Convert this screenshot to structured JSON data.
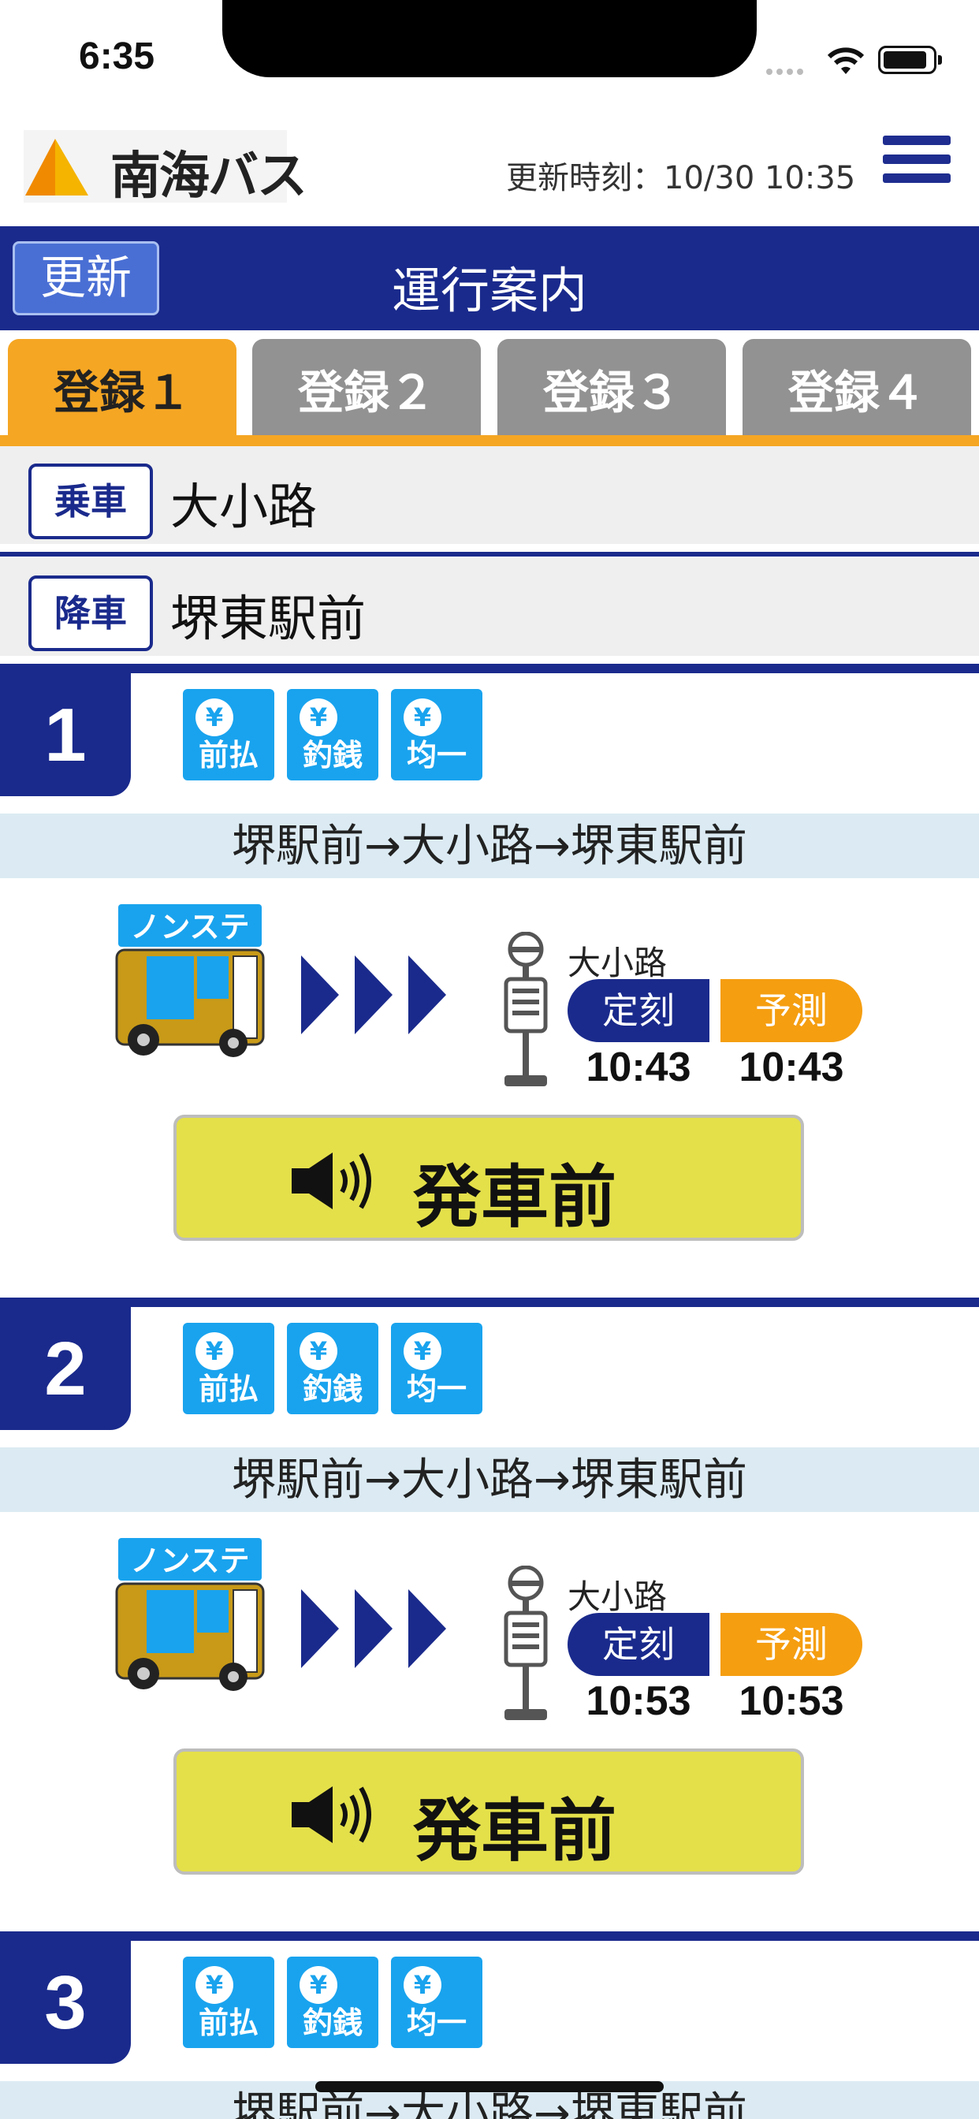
{
  "status_bar": {
    "time": "6:35"
  },
  "header": {
    "brand": "南海バス",
    "updated": "更新時刻：10/30 10:35"
  },
  "titlebar": {
    "refresh_label": "更新",
    "title": "運行案内"
  },
  "tabs": [
    {
      "label": "登録１",
      "active": true
    },
    {
      "label": "登録２",
      "active": false
    },
    {
      "label": "登録３",
      "active": false
    },
    {
      "label": "登録４",
      "active": false
    }
  ],
  "boarding": {
    "label": "乗車",
    "stop": "大小路"
  },
  "alighting": {
    "label": "降車",
    "stop": "堺東駅前"
  },
  "features": [
    {
      "icon": "yen-icon",
      "symbol": "¥",
      "label": "前払"
    },
    {
      "icon": "hand-coin-icon",
      "symbol": "¥",
      "label": "釣銭"
    },
    {
      "icon": "yen-icon",
      "symbol": "¥",
      "label": "均一"
    }
  ],
  "buses": [
    {
      "number": "1",
      "route": "堺駅前→大小路→堺東駅前",
      "bus_tag": "ノンステ",
      "stop": "大小路",
      "scheduled_label": "定刻",
      "predicted_label": "予測",
      "scheduled": "10:43",
      "predicted": "10:43",
      "status": "発車前"
    },
    {
      "number": "2",
      "route": "堺駅前→大小路→堺東駅前",
      "bus_tag": "ノンステ",
      "stop": "大小路",
      "scheduled_label": "定刻",
      "predicted_label": "予測",
      "scheduled": "10:53",
      "predicted": "10:53",
      "status": "発車前"
    },
    {
      "number": "3",
      "route": "堺駅前→大小路→堺東駅前"
    }
  ],
  "colors": {
    "navy": "#1a2a8c",
    "orange": "#f5a623",
    "status_yellow": "#e4e04a",
    "feature_blue": "#19a3ee"
  }
}
